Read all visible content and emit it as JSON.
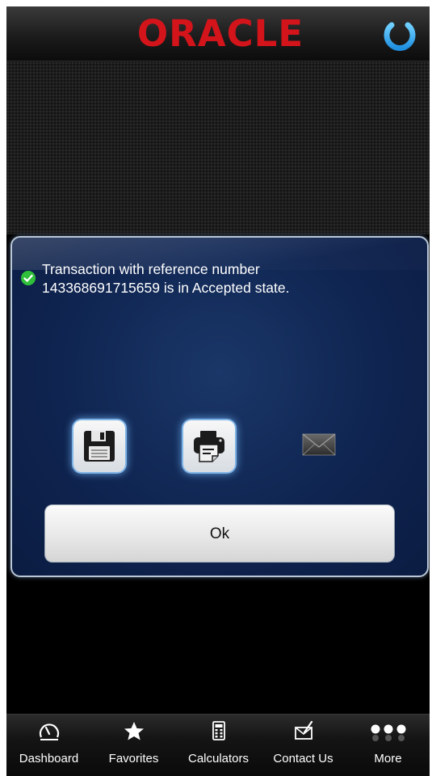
{
  "header": {
    "logo_text": "ORACLE",
    "logo_color": "#d4141b",
    "power_icon": "power-icon"
  },
  "dialog": {
    "status_icon": "check-circle-icon",
    "message_line1": "Transaction with reference number",
    "message_line2": "143368691715659 is in Accepted state.",
    "actions": [
      {
        "name": "save",
        "icon": "floppy-disk-icon"
      },
      {
        "name": "print",
        "icon": "printer-icon"
      },
      {
        "name": "email",
        "icon": "envelope-icon"
      }
    ],
    "ok_label": "Ok"
  },
  "tabbar": {
    "items": [
      {
        "label": "Dashboard",
        "icon": "speedometer-icon"
      },
      {
        "label": "Favorites",
        "icon": "star-icon"
      },
      {
        "label": "Calculators",
        "icon": "calculator-icon"
      },
      {
        "label": "Contact Us",
        "icon": "contact-icon"
      },
      {
        "label": "More",
        "icon": "more-dots-icon"
      }
    ]
  },
  "colors": {
    "dialog_bg": "#0f2450",
    "accent_glow": "#7fb4e6",
    "success": "#2fbf3a"
  }
}
